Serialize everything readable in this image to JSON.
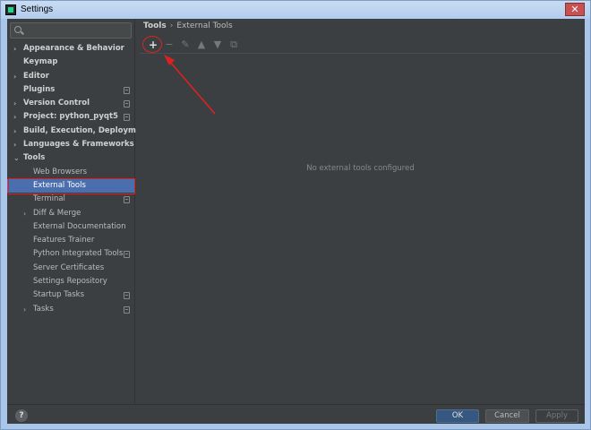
{
  "window": {
    "title": "Settings",
    "close_glyph": "✕"
  },
  "search": {
    "placeholder": ""
  },
  "sidebar": {
    "items": [
      {
        "label": "Appearance & Behavior",
        "bold": true,
        "level": 0,
        "arrow": "›",
        "doc": false
      },
      {
        "label": "Keymap",
        "bold": true,
        "level": 0,
        "arrow": "",
        "doc": false
      },
      {
        "label": "Editor",
        "bold": true,
        "level": 0,
        "arrow": "›",
        "doc": false
      },
      {
        "label": "Plugins",
        "bold": true,
        "level": 0,
        "arrow": "",
        "doc": true
      },
      {
        "label": "Version Control",
        "bold": true,
        "level": 0,
        "arrow": "›",
        "doc": true
      },
      {
        "label": "Project: python_pyqt5",
        "bold": true,
        "level": 0,
        "arrow": "›",
        "doc": true
      },
      {
        "label": "Build, Execution, Deployment",
        "bold": true,
        "level": 0,
        "arrow": "›",
        "doc": false
      },
      {
        "label": "Languages & Frameworks",
        "bold": true,
        "level": 0,
        "arrow": "›",
        "doc": false
      },
      {
        "label": "Tools",
        "bold": true,
        "level": 0,
        "arrow": "⌄",
        "doc": false
      },
      {
        "label": "Web Browsers",
        "bold": false,
        "level": 1,
        "arrow": "",
        "doc": false
      },
      {
        "label": "External Tools",
        "bold": false,
        "level": 1,
        "arrow": "",
        "doc": false,
        "selected": true
      },
      {
        "label": "Terminal",
        "bold": false,
        "level": 1,
        "arrow": "",
        "doc": true
      },
      {
        "label": "Diff & Merge",
        "bold": false,
        "level": 1,
        "arrow": "›",
        "doc": false
      },
      {
        "label": "External Documentation",
        "bold": false,
        "level": 1,
        "arrow": "",
        "doc": false
      },
      {
        "label": "Features Trainer",
        "bold": false,
        "level": 1,
        "arrow": "",
        "doc": false
      },
      {
        "label": "Python Integrated Tools",
        "bold": false,
        "level": 1,
        "arrow": "",
        "doc": true
      },
      {
        "label": "Server Certificates",
        "bold": false,
        "level": 1,
        "arrow": "",
        "doc": false
      },
      {
        "label": "Settings Repository",
        "bold": false,
        "level": 1,
        "arrow": "",
        "doc": false
      },
      {
        "label": "Startup Tasks",
        "bold": false,
        "level": 1,
        "arrow": "",
        "doc": true
      },
      {
        "label": "Tasks",
        "bold": false,
        "level": 1,
        "arrow": "›",
        "doc": true
      }
    ]
  },
  "breadcrumb": {
    "root": "Tools",
    "separator": "›",
    "current": "External Tools"
  },
  "toolbar": {
    "add_glyph": "+",
    "remove_glyph": "−",
    "edit_glyph": "✎",
    "up_glyph": "▲",
    "down_glyph": "▼",
    "copy_glyph": "⧉"
  },
  "main": {
    "empty_text": "No external tools configured"
  },
  "footer": {
    "help_label": "?",
    "ok_label": "OK",
    "cancel_label": "Cancel",
    "apply_label": "Apply"
  },
  "colors": {
    "selection": "#4b6eaf",
    "annotation_red": "#e02020",
    "panel_bg": "#3c3f41"
  }
}
